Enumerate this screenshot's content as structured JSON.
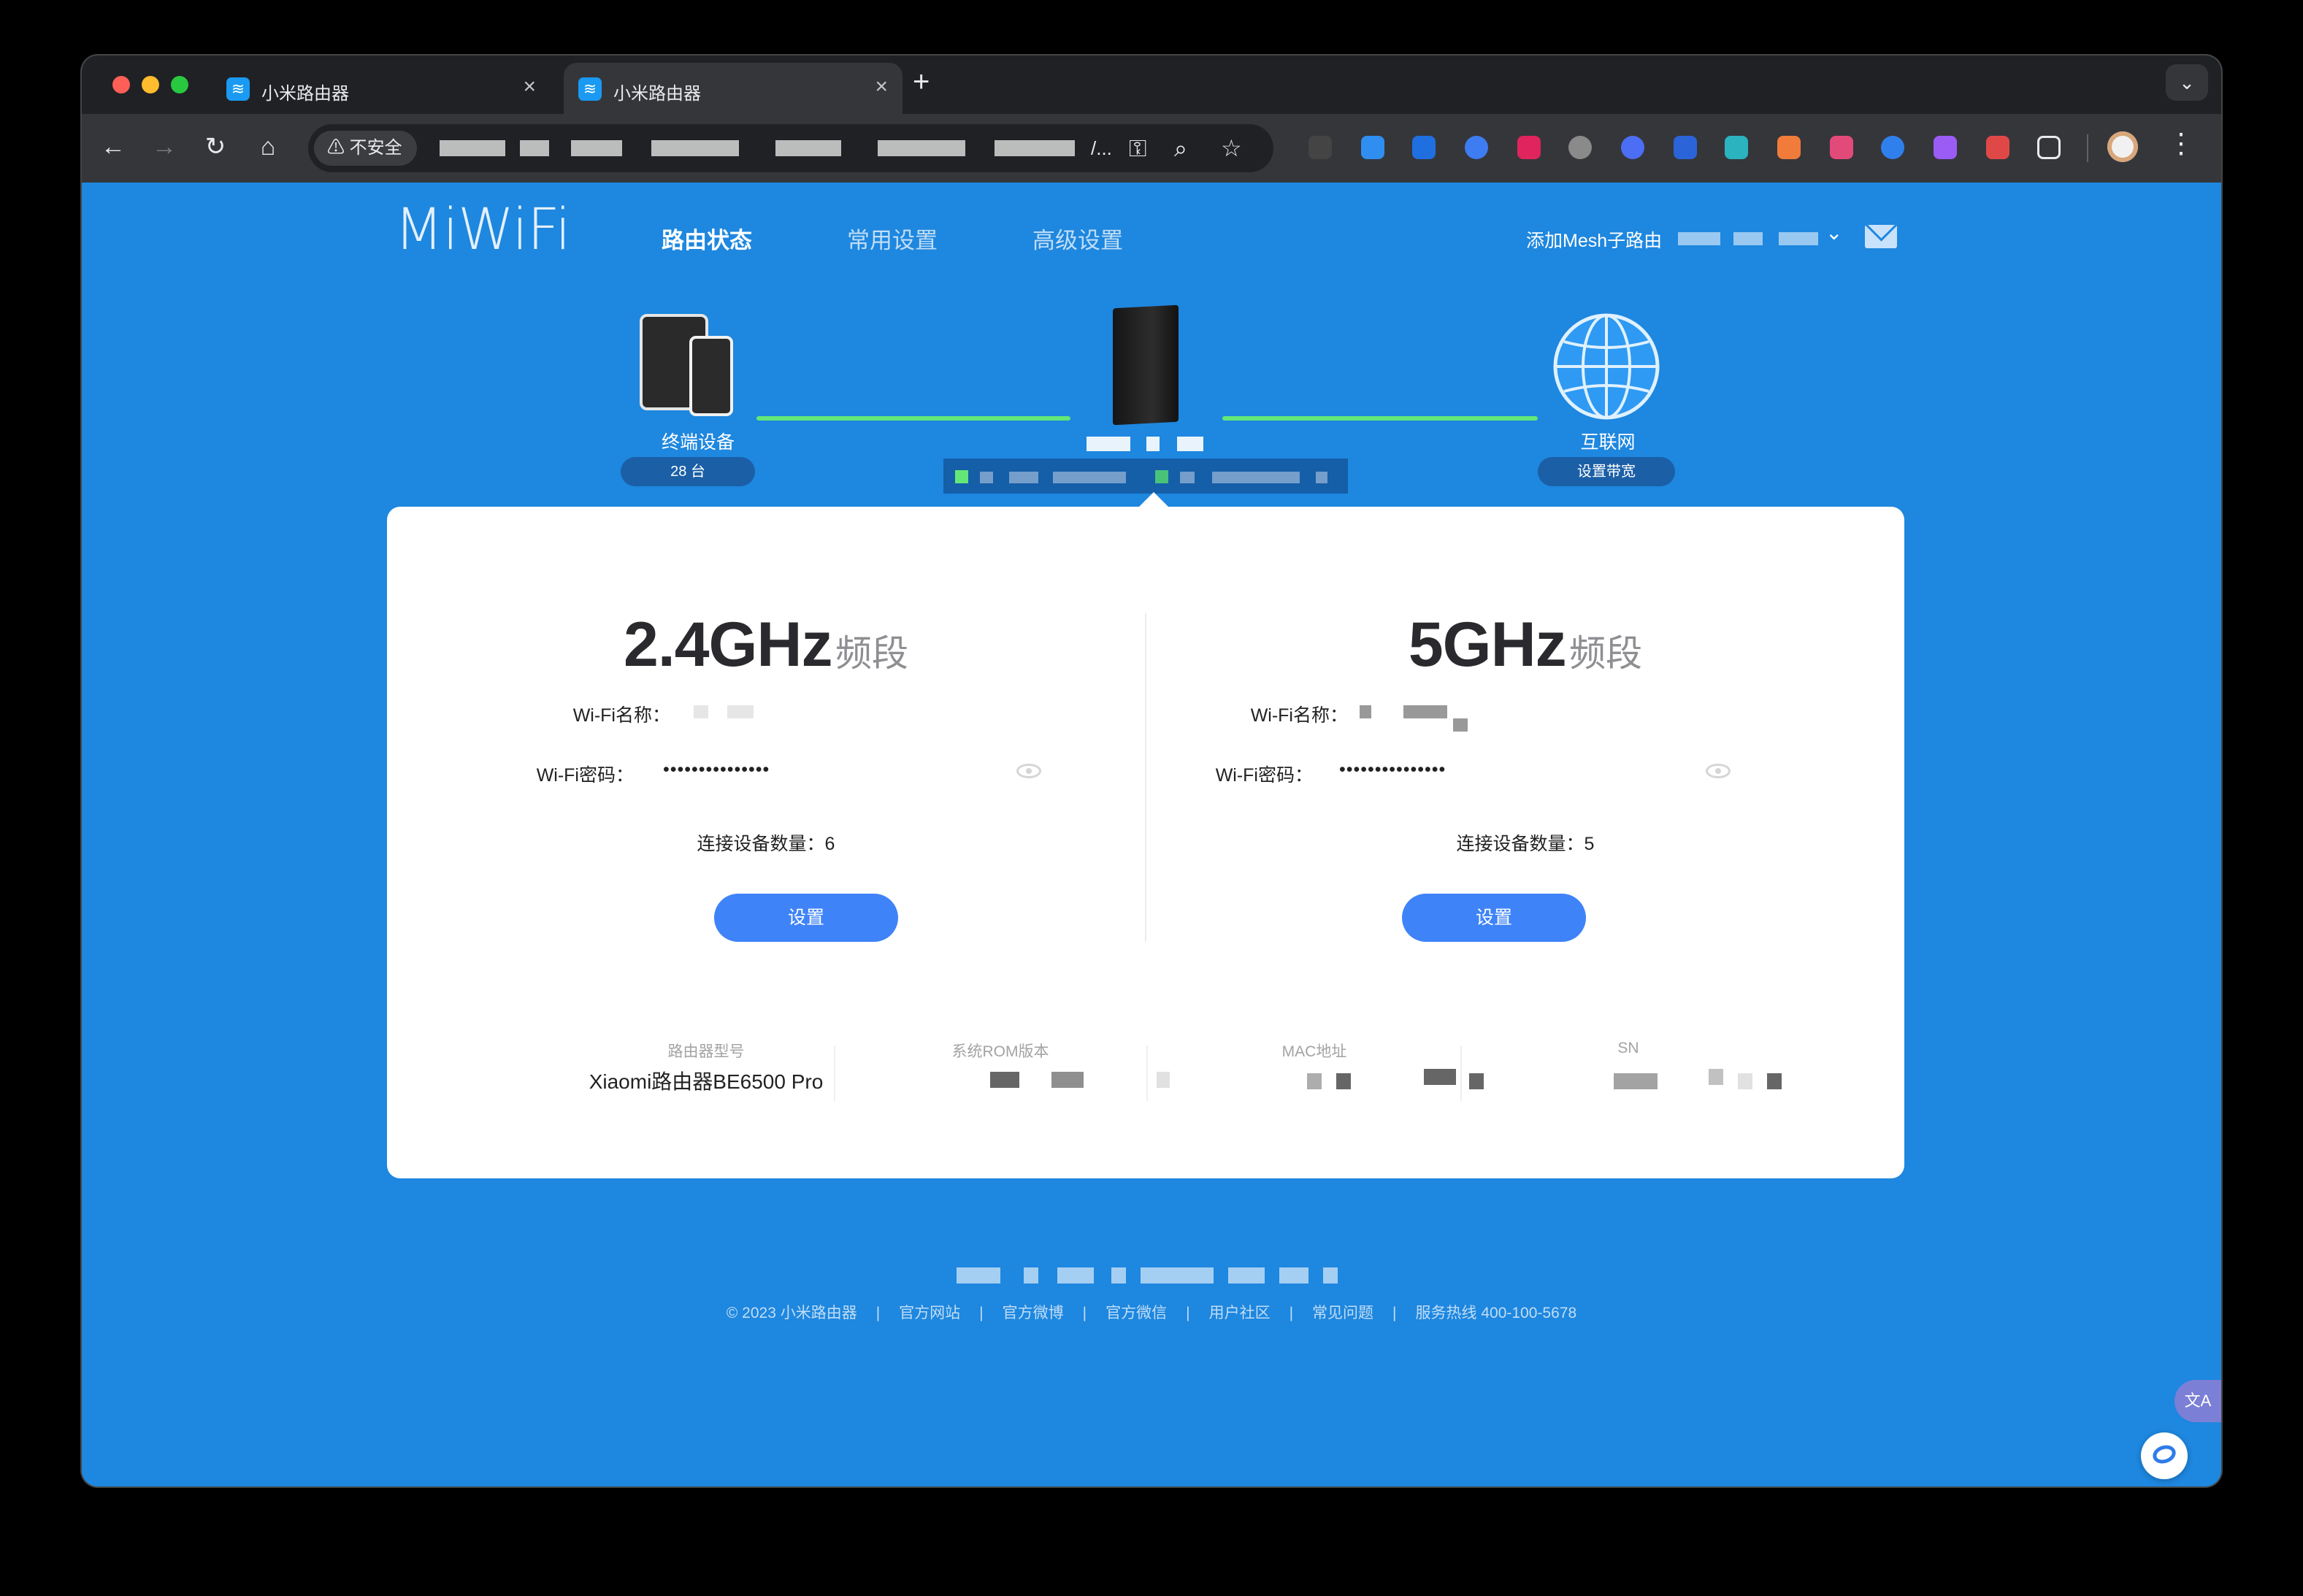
{
  "browser": {
    "tabs": [
      {
        "title": "小米路由器",
        "active": false
      },
      {
        "title": "小米路由器",
        "active": true
      }
    ],
    "new_tab": "+",
    "security_label": "不安全",
    "url_tail": "/..."
  },
  "header": {
    "logo": "MiWiFi",
    "nav": [
      "路由状态",
      "常用设置",
      "高级设置"
    ],
    "active_nav": "路由状态",
    "mesh_link": "添加Mesh子路由"
  },
  "topology": {
    "devices": {
      "label": "终端设备",
      "count": "28 台"
    },
    "internet": {
      "label": "互联网",
      "action": "设置带宽"
    },
    "link_color": "#63E878"
  },
  "bands": [
    {
      "band": "2.4GHz",
      "band_word": "频段",
      "ssid_label": "Wi-Fi名称：",
      "password_label": "Wi-Fi密码：",
      "password_mask": "•••••••••••••••",
      "connected_label": "连接设备数量：6",
      "button": "设置"
    },
    {
      "band": "5GHz",
      "band_word": "频段",
      "ssid_label": "Wi-Fi名称：",
      "password_label": "Wi-Fi密码：",
      "password_mask": "•••••••••••••••",
      "connected_label": "连接设备数量：5",
      "button": "设置"
    }
  ],
  "info": {
    "model_label": "路由器型号",
    "model_value": "Xiaomi路由器BE6500 Pro",
    "rom_label": "系统ROM版本",
    "mac_label": "MAC地址",
    "sn_label": "SN"
  },
  "footer": {
    "copyright": "© 2023 小米路由器",
    "links": [
      "官方网站",
      "官方微博",
      "官方微信",
      "用户社区",
      "常见问题",
      "服务热线 400-100-5678"
    ]
  },
  "colors": {
    "page_bg": "#1E87DF",
    "button": "#3F83F8",
    "led_green": "#63E878"
  }
}
